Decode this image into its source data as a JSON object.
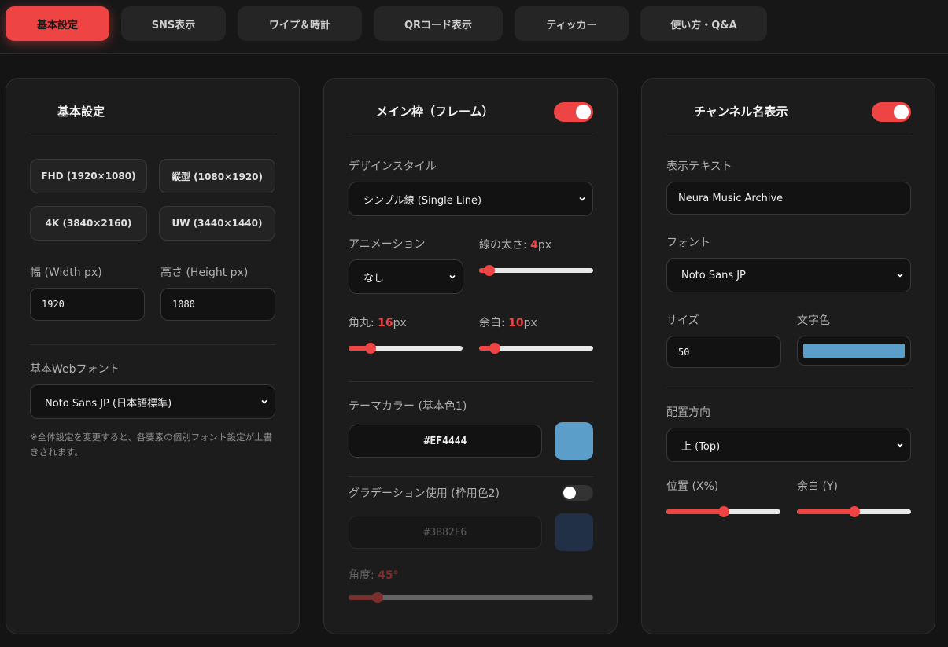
{
  "tabs": [
    {
      "label": "基本設定",
      "active": true
    },
    {
      "label": "SNS表示",
      "active": false
    },
    {
      "label": "ワイプ＆時計",
      "active": false
    },
    {
      "label": "QRコード表示",
      "active": false
    },
    {
      "label": "ティッカー",
      "active": false
    },
    {
      "label": "使い方・Q&A",
      "active": false
    }
  ],
  "basic": {
    "title": "基本設定",
    "presets": [
      "FHD (1920×1080)",
      "縦型 (1080×1920)",
      "4K (3840×2160)",
      "UW (3440×1440)"
    ],
    "width_label": "幅 (Width px)",
    "width_value": "1920",
    "height_label": "高さ (Height px)",
    "height_value": "1080",
    "font_label": "基本Webフォント",
    "font_value": "Noto Sans JP (日本語標準)",
    "note": "※全体設定を変更すると、各要素の個別フォント設定が上書きされます。"
  },
  "frame": {
    "title": "メイン枠（フレーム）",
    "enabled": true,
    "style_label": "デザインスタイル",
    "style_value": "シンプル線 (Single Line)",
    "anim_label": "アニメーション",
    "anim_value": "なし",
    "line_label": "線の太さ: ",
    "line_value": "4",
    "line_unit": "px",
    "line_fraction": 0.09,
    "radius_label": "角丸: ",
    "radius_value": "16",
    "radius_unit": "px",
    "radius_fraction": 0.19,
    "padding_label": "余白: ",
    "padding_value": "10",
    "padding_unit": "px",
    "padding_fraction": 0.14,
    "theme_label": "テーマカラー (基本色1)",
    "theme_hex": "#EF4444",
    "theme_swatch": "#5b9ec9",
    "grad_label": "グラデーション使用 (枠用色2)",
    "grad_enabled": false,
    "grad_hex": "#3B82F6",
    "grad_swatch": "#2a4a7d",
    "angle_label": "角度: ",
    "angle_value": "45",
    "angle_unit": "°",
    "angle_fraction": 0.12
  },
  "channel": {
    "title": "チャンネル名表示",
    "enabled": true,
    "text_label": "表示テキスト",
    "text_value": "Neura Music Archive",
    "font_label": "フォント",
    "font_value": "Noto Sans JP",
    "size_label": "サイズ",
    "size_value": "50",
    "color_label": "文字色",
    "color_value": "#5b9ec9",
    "direction_label": "配置方向",
    "direction_value": "上 (Top)",
    "posx_label": "位置 (X%)",
    "posx_fraction": 0.5,
    "margin_label": "余白 (Y)",
    "margin_fraction": 0.5
  },
  "colors": {
    "accent": "#ef4444",
    "background": "#141414",
    "panel": "#1c1c1c"
  }
}
